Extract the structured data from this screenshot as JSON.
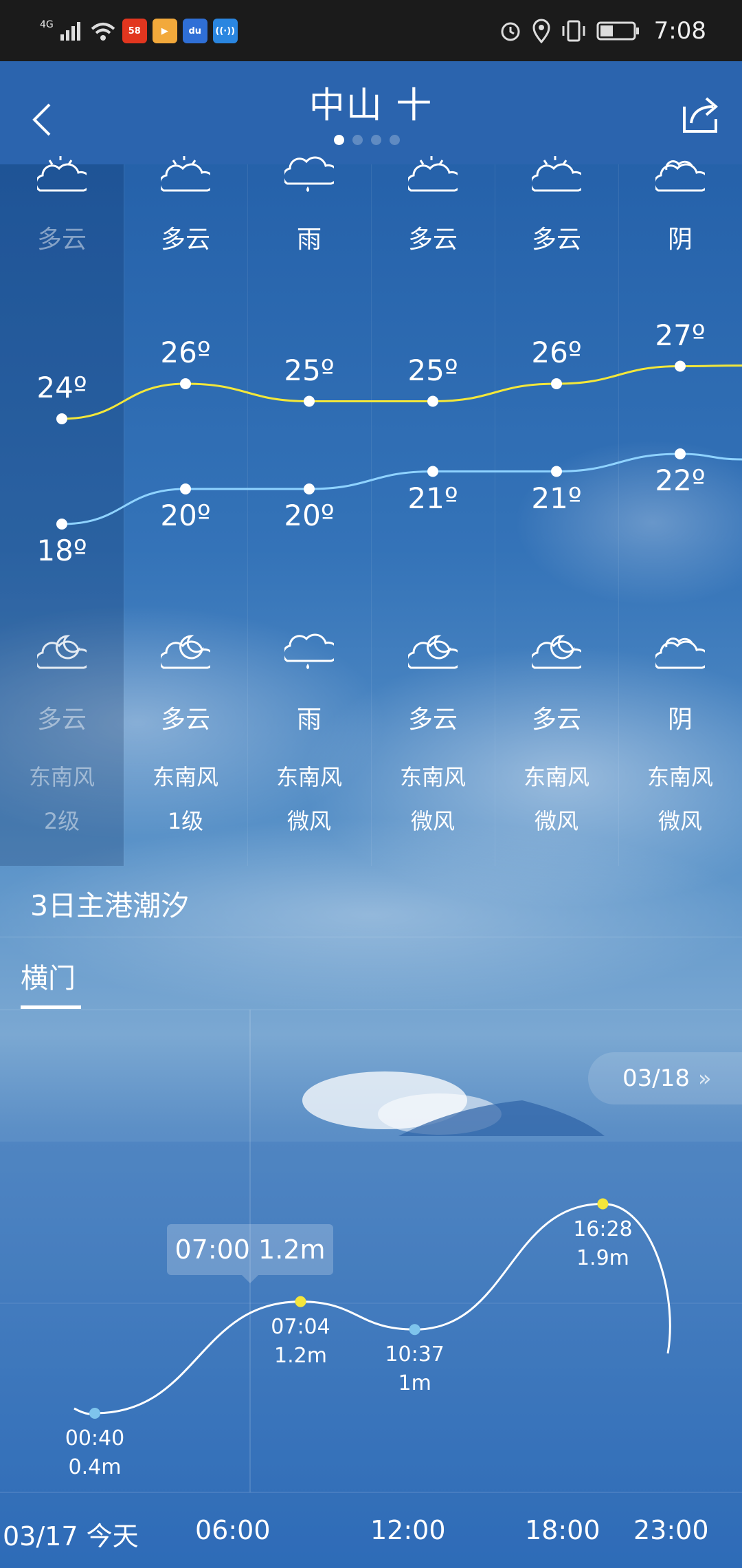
{
  "status_bar": {
    "network": "4G",
    "time": "7:08",
    "app_icons": [
      {
        "name": "58-app-icon",
        "text": "58",
        "color": "#e2361f"
      },
      {
        "name": "video-app-icon",
        "text": "▶",
        "color": "#f2a93b"
      },
      {
        "name": "baidu-app-icon",
        "text": "du",
        "color": "#2f6fd6"
      },
      {
        "name": "wifi-share-app-icon",
        "text": "((·))",
        "color": "#2a86e0"
      }
    ]
  },
  "header": {
    "title": "中山 十",
    "page_count": 4,
    "active_page": 1
  },
  "forecast": {
    "days": [
      {
        "day_condition": "多云",
        "night_condition": "多云",
        "high": "24º",
        "low": "18º",
        "wind_dir": "东南风",
        "wind_level": "2级",
        "day_icon": "cloudy-icon",
        "night_icon": "partly-cloudy-night-icon"
      },
      {
        "day_condition": "多云",
        "night_condition": "多云",
        "high": "26º",
        "low": "20º",
        "wind_dir": "东南风",
        "wind_level": "1级",
        "day_icon": "cloudy-icon",
        "night_icon": "partly-cloudy-night-icon"
      },
      {
        "day_condition": "雨",
        "night_condition": "雨",
        "high": "25º",
        "low": "20º",
        "wind_dir": "东南风",
        "wind_level": "微风",
        "day_icon": "rain-icon",
        "night_icon": "rain-icon"
      },
      {
        "day_condition": "多云",
        "night_condition": "多云",
        "high": "25º",
        "low": "21º",
        "wind_dir": "东南风",
        "wind_level": "微风",
        "day_icon": "cloudy-icon",
        "night_icon": "partly-cloudy-night-icon"
      },
      {
        "day_condition": "多云",
        "night_condition": "多云",
        "high": "26º",
        "low": "21º",
        "wind_dir": "东南风",
        "wind_level": "微风",
        "day_icon": "cloudy-icon",
        "night_icon": "partly-cloudy-night-icon"
      },
      {
        "day_condition": "阴",
        "night_condition": "阴",
        "high": "27º",
        "low": "22º",
        "wind_dir": "东南风",
        "wind_level": "微风",
        "day_icon": "overcast-icon",
        "night_icon": "overcast-icon"
      }
    ],
    "high_values": [
      24,
      26,
      25,
      25,
      26,
      27
    ],
    "low_values": [
      18,
      20,
      20,
      21,
      21,
      22
    ],
    "high_line_color": "#f3e73a",
    "low_line_color": "#8fd3ff"
  },
  "tide": {
    "title": "3日主港潮汐",
    "tab": "横门",
    "next_date": "03/18",
    "tooltip": "07:00 1.2m",
    "points": [
      {
        "time": "00:40",
        "height": "0.4m",
        "type": "low"
      },
      {
        "time": "07:04",
        "height": "1.2m",
        "type": "high"
      },
      {
        "time": "10:37",
        "height": "1m",
        "type": "low"
      },
      {
        "time": "16:28",
        "height": "1.9m",
        "type": "high"
      }
    ],
    "axis": [
      "03/17 今天",
      "06:00",
      "12:00",
      "18:00",
      "23:00"
    ],
    "high_marker_color": "#f5e63b",
    "low_marker_color": "#7ec4ec"
  }
}
